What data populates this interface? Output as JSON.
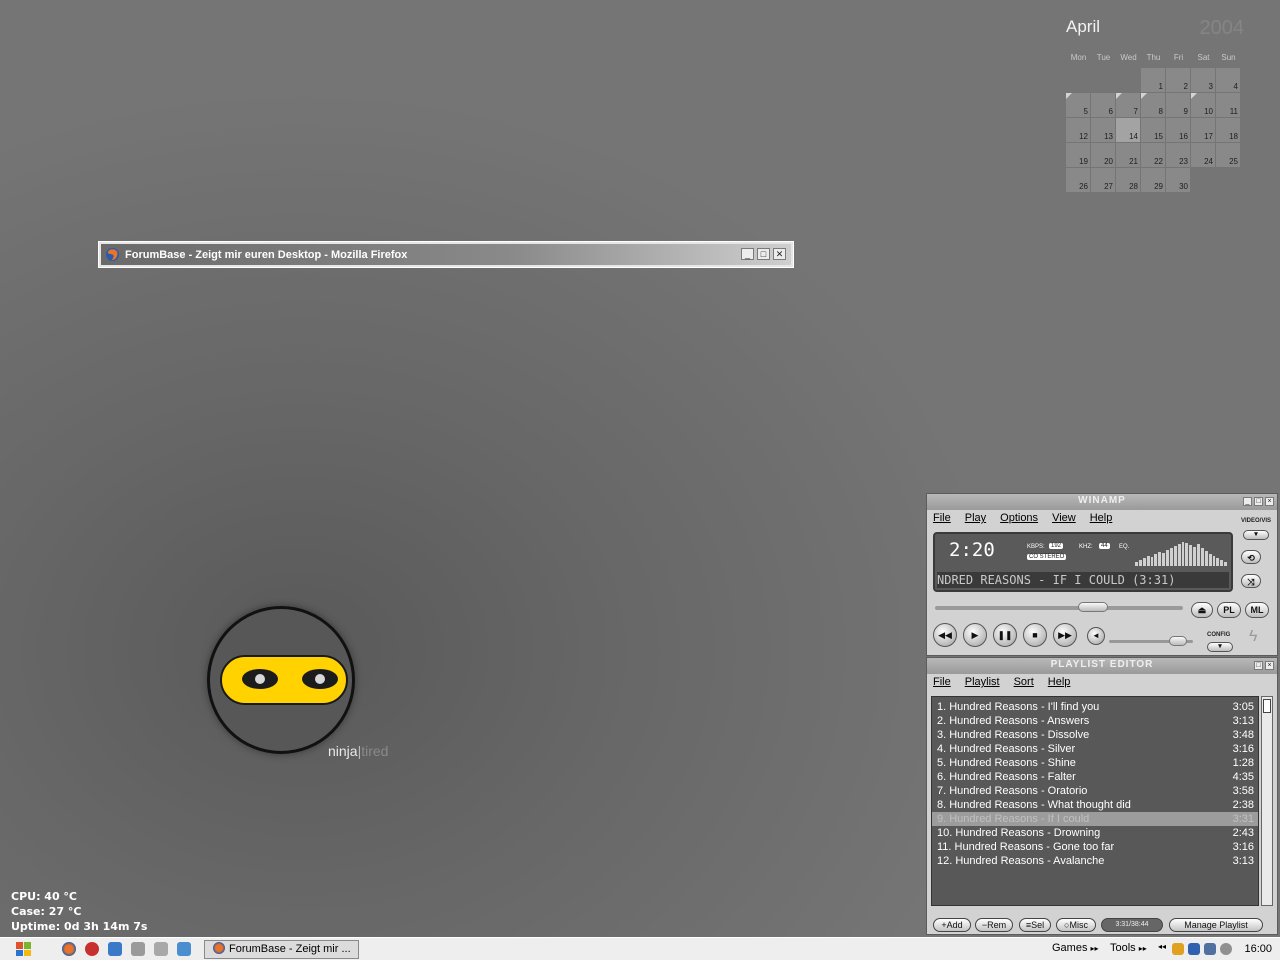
{
  "calendar": {
    "month": "April",
    "year": "2004",
    "weekdays": [
      "Mon",
      "Tue",
      "Wed",
      "Thu",
      "Fri",
      "Sat",
      "Sun"
    ],
    "leading_blanks": 3,
    "days": [
      "1",
      "2",
      "3",
      "4",
      "5",
      "6",
      "7",
      "8",
      "9",
      "10",
      "11",
      "12",
      "13",
      "14",
      "15",
      "16",
      "17",
      "18",
      "19",
      "20",
      "21",
      "22",
      "23",
      "24",
      "25",
      "26",
      "27",
      "28",
      "29",
      "30"
    ],
    "today": "14",
    "flagged": [
      "5",
      "7",
      "8",
      "10"
    ]
  },
  "firefox_window": {
    "title": "ForumBase - Zeigt mir euren Desktop - Mozilla Firefox",
    "minimize": "_",
    "maximize": "□",
    "close": "✕"
  },
  "ninja_logo": {
    "word1": "ninja",
    "separator": "|",
    "word2": "tired"
  },
  "system_monitor": {
    "cpu": "CPU: 40 °C",
    "case": "Case: 27 °C",
    "uptime": "Uptime: 0d 3h 14m 7s"
  },
  "winamp": {
    "title": "WINAMP",
    "menu": [
      "File",
      "Play",
      "Options",
      "View",
      "Help"
    ],
    "time": "2:20",
    "kbps_label": "KBPS:",
    "kbps": "192",
    "khz_label": "KHZ:",
    "khz": "44",
    "eq_label": "EQ.",
    "stereo": "CO STEREO",
    "scroll_text": "NDRED REASONS - IF I COULD (3:31)",
    "side_label": "VIDEO/VIS",
    "config_label": "CONFIG",
    "pl_button": "PL",
    "ml_button": "ML",
    "seek_position": 0.62,
    "volume_position": 0.85,
    "spectrum": [
      4,
      6,
      8,
      10,
      9,
      12,
      14,
      13,
      16,
      18,
      20,
      22,
      24,
      23,
      21,
      19,
      22,
      18,
      15,
      12,
      10,
      8,
      6,
      4
    ]
  },
  "playlist": {
    "title": "PLAYLIST EDITOR",
    "menu": [
      "File",
      "Playlist",
      "Sort",
      "Help"
    ],
    "selected_index": 8,
    "items": [
      {
        "label": "1. Hundred Reasons - I'll find you",
        "time": "3:05"
      },
      {
        "label": "2. Hundred Reasons - Answers",
        "time": "3:13"
      },
      {
        "label": "3. Hundred Reasons - Dissolve",
        "time": "3:48"
      },
      {
        "label": "4. Hundred Reasons - Silver",
        "time": "3:16"
      },
      {
        "label": "5. Hundred Reasons - Shine",
        "time": "1:28"
      },
      {
        "label": "6. Hundred Reasons - Falter",
        "time": "4:35"
      },
      {
        "label": "7. Hundred Reasons - Oratorio",
        "time": "3:58"
      },
      {
        "label": "8. Hundred Reasons - What thought did",
        "time": "2:38"
      },
      {
        "label": "9. Hundred Reasons - If I could",
        "time": "3:31"
      },
      {
        "label": "10. Hundred Reasons - Drowning",
        "time": "2:43"
      },
      {
        "label": "11. Hundred Reasons - Gone too far",
        "time": "3:16"
      },
      {
        "label": "12. Hundred Reasons - Avalanche",
        "time": "3:13"
      }
    ],
    "buttons": {
      "add": "+Add",
      "rem": "−Rem",
      "sel": "≡Sel",
      "misc": "○Misc",
      "counter": "3:31/38:44",
      "manage": "Manage Playlist"
    }
  },
  "taskbar": {
    "task_label": "ForumBase - Zeigt mir ...",
    "games": "Games",
    "tools": "Tools",
    "clock": "16:00"
  },
  "colors": {
    "accent_yellow": "#ffd200",
    "desktop_gray": "#676767"
  }
}
